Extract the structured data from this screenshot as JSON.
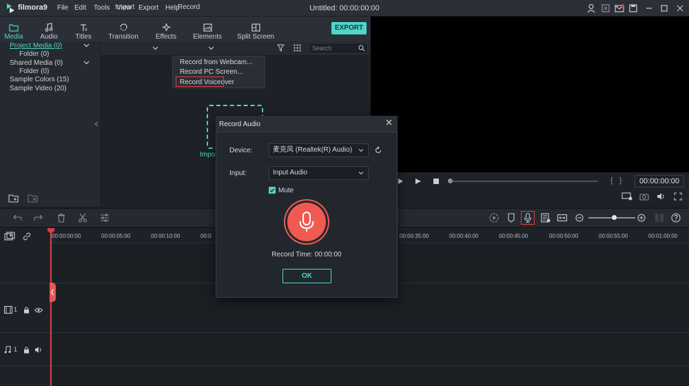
{
  "app": {
    "logo_text": "filmora9",
    "title": "Untitled: 00:00:00:00",
    "menu": [
      "File",
      "Edit",
      "Tools",
      "View",
      "Export",
      "Help"
    ]
  },
  "tabs": [
    "Media",
    "Audio",
    "Titles",
    "Transition",
    "Effects",
    "Elements",
    "Split Screen"
  ],
  "export_label": "EXPORT",
  "library": {
    "items": [
      {
        "label": "Project Media (0)",
        "active": true
      },
      {
        "label": "Folder (0)",
        "sub": true
      },
      {
        "label": "Shared Media (0)"
      },
      {
        "label": "Folder (0)",
        "sub": true
      },
      {
        "label": "Sample Colors (15)"
      },
      {
        "label": "Sample Video (20)"
      }
    ]
  },
  "media_toolbar": {
    "import_label": "Import",
    "record_label": "Record",
    "search_placeholder": "Search"
  },
  "record_menu": [
    "Record from Webcam...",
    "Record PC Screen...",
    "Record Voiceover"
  ],
  "import_hint": "Impo",
  "preview": {
    "timecode": "00:00:00:00"
  },
  "timeline": {
    "ticks": [
      "00:00:00:00",
      "00:00:05:00",
      "00:00:10:00",
      "00:0",
      "00:00:35:00",
      "00:00:40:00",
      "00:00:45:00",
      "00:00:50:00",
      "00:00:55:00",
      "00:01:00:00"
    ],
    "video_track": "1",
    "audio_track": "1"
  },
  "dialog": {
    "title": "Record Audio",
    "device_label": "Device:",
    "device_value": "麦克风 (Realtek(R) Audio)",
    "input_label": "Input:",
    "input_value": "Input Audio",
    "mute_label": "Mute",
    "record_time": "Record Time: 00:00:00",
    "ok_label": "OK"
  },
  "colors": {
    "accent": "#4fd6c9",
    "record": "#f05a51",
    "highlight": "#e03c3c"
  }
}
